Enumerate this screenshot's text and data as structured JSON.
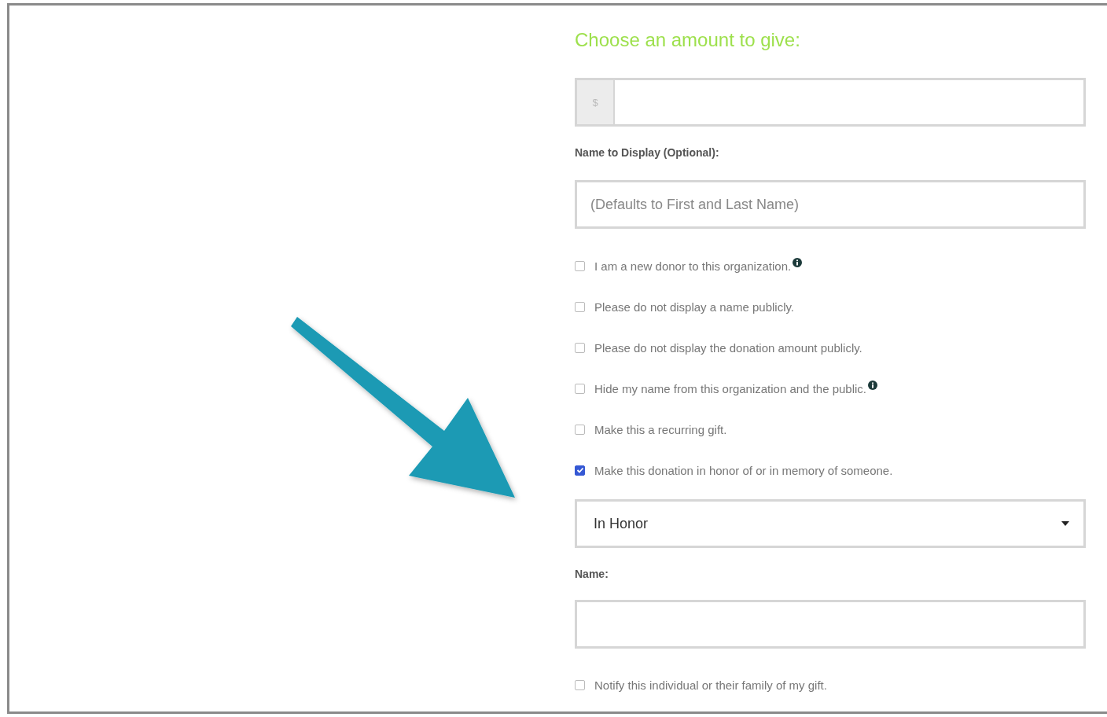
{
  "heading": "Choose an amount to give:",
  "amount_field": {
    "prefix": "$"
  },
  "display_name": {
    "label": "Name to Display (Optional):",
    "placeholder": "(Defaults to First and Last Name)"
  },
  "options": [
    {
      "label": "I am a new donor to this organization.",
      "checked": false,
      "info": true
    },
    {
      "label": "Please do not display a name publicly.",
      "checked": false,
      "info": false
    },
    {
      "label": "Please do not display the donation amount publicly.",
      "checked": false,
      "info": false
    },
    {
      "label": "Hide my name from this organization and the public.",
      "checked": false,
      "info": true
    },
    {
      "label": "Make this a recurring gift.",
      "checked": false,
      "info": false
    },
    {
      "label": "Make this donation in honor of or in memory of someone.",
      "checked": true,
      "info": false
    }
  ],
  "tribute_select": {
    "value": "In Honor"
  },
  "honoree_name": {
    "label": "Name:"
  },
  "notify_option": {
    "label": "Notify this individual or their family of my gift.",
    "checked": false
  }
}
